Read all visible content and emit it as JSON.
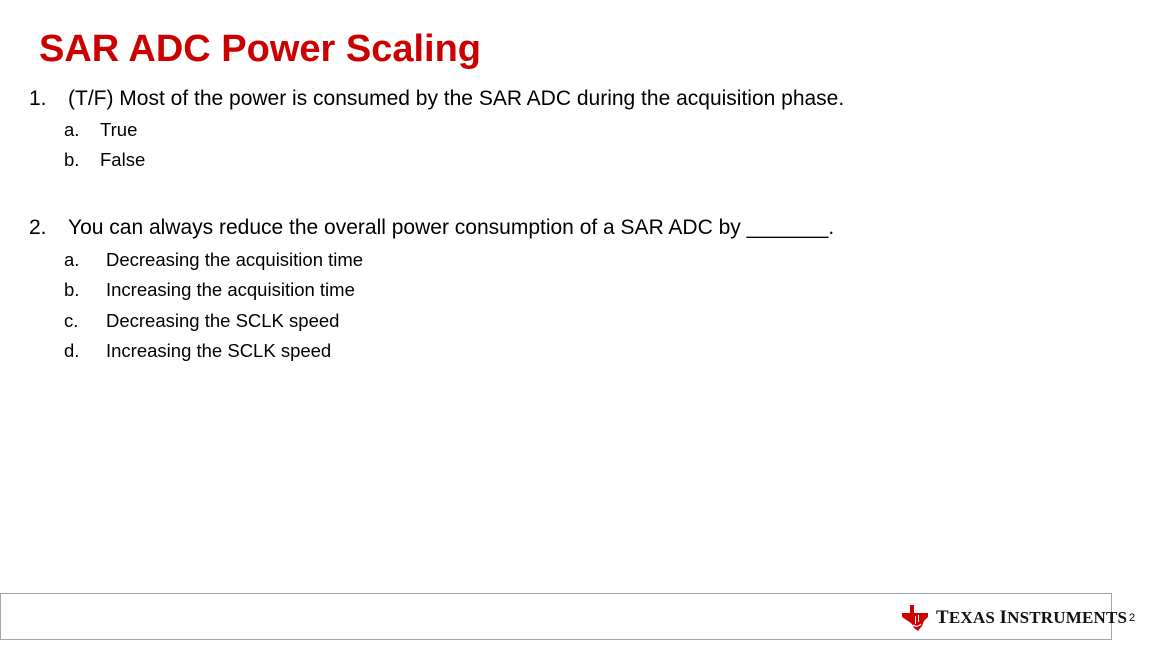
{
  "slide": {
    "title": "SAR ADC Power Scaling",
    "page_number": "2"
  },
  "questions": [
    {
      "number": "1.",
      "text": "(T/F) Most of the power is consumed by the SAR ADC during the acquisition phase.",
      "options": [
        {
          "letter": "a.",
          "text": "True"
        },
        {
          "letter": "b.",
          "text": "False"
        }
      ]
    },
    {
      "number": "2.",
      "text": "You can always reduce the overall power consumption of a SAR ADC by _______.",
      "options": [
        {
          "letter": "a.",
          "text": "Decreasing the acquisition time"
        },
        {
          "letter": "b.",
          "text": "Increasing the acquisition time"
        },
        {
          "letter": "c.",
          "text": "Decreasing the SCLK speed"
        },
        {
          "letter": "d.",
          "text": "Increasing the SCLK speed"
        }
      ]
    }
  ],
  "footer": {
    "logo_text_1": "T",
    "logo_text_2": "EXAS ",
    "logo_text_3": "I",
    "logo_text_4": "NSTRUMENTS",
    "brand_color": "#cc0000"
  }
}
